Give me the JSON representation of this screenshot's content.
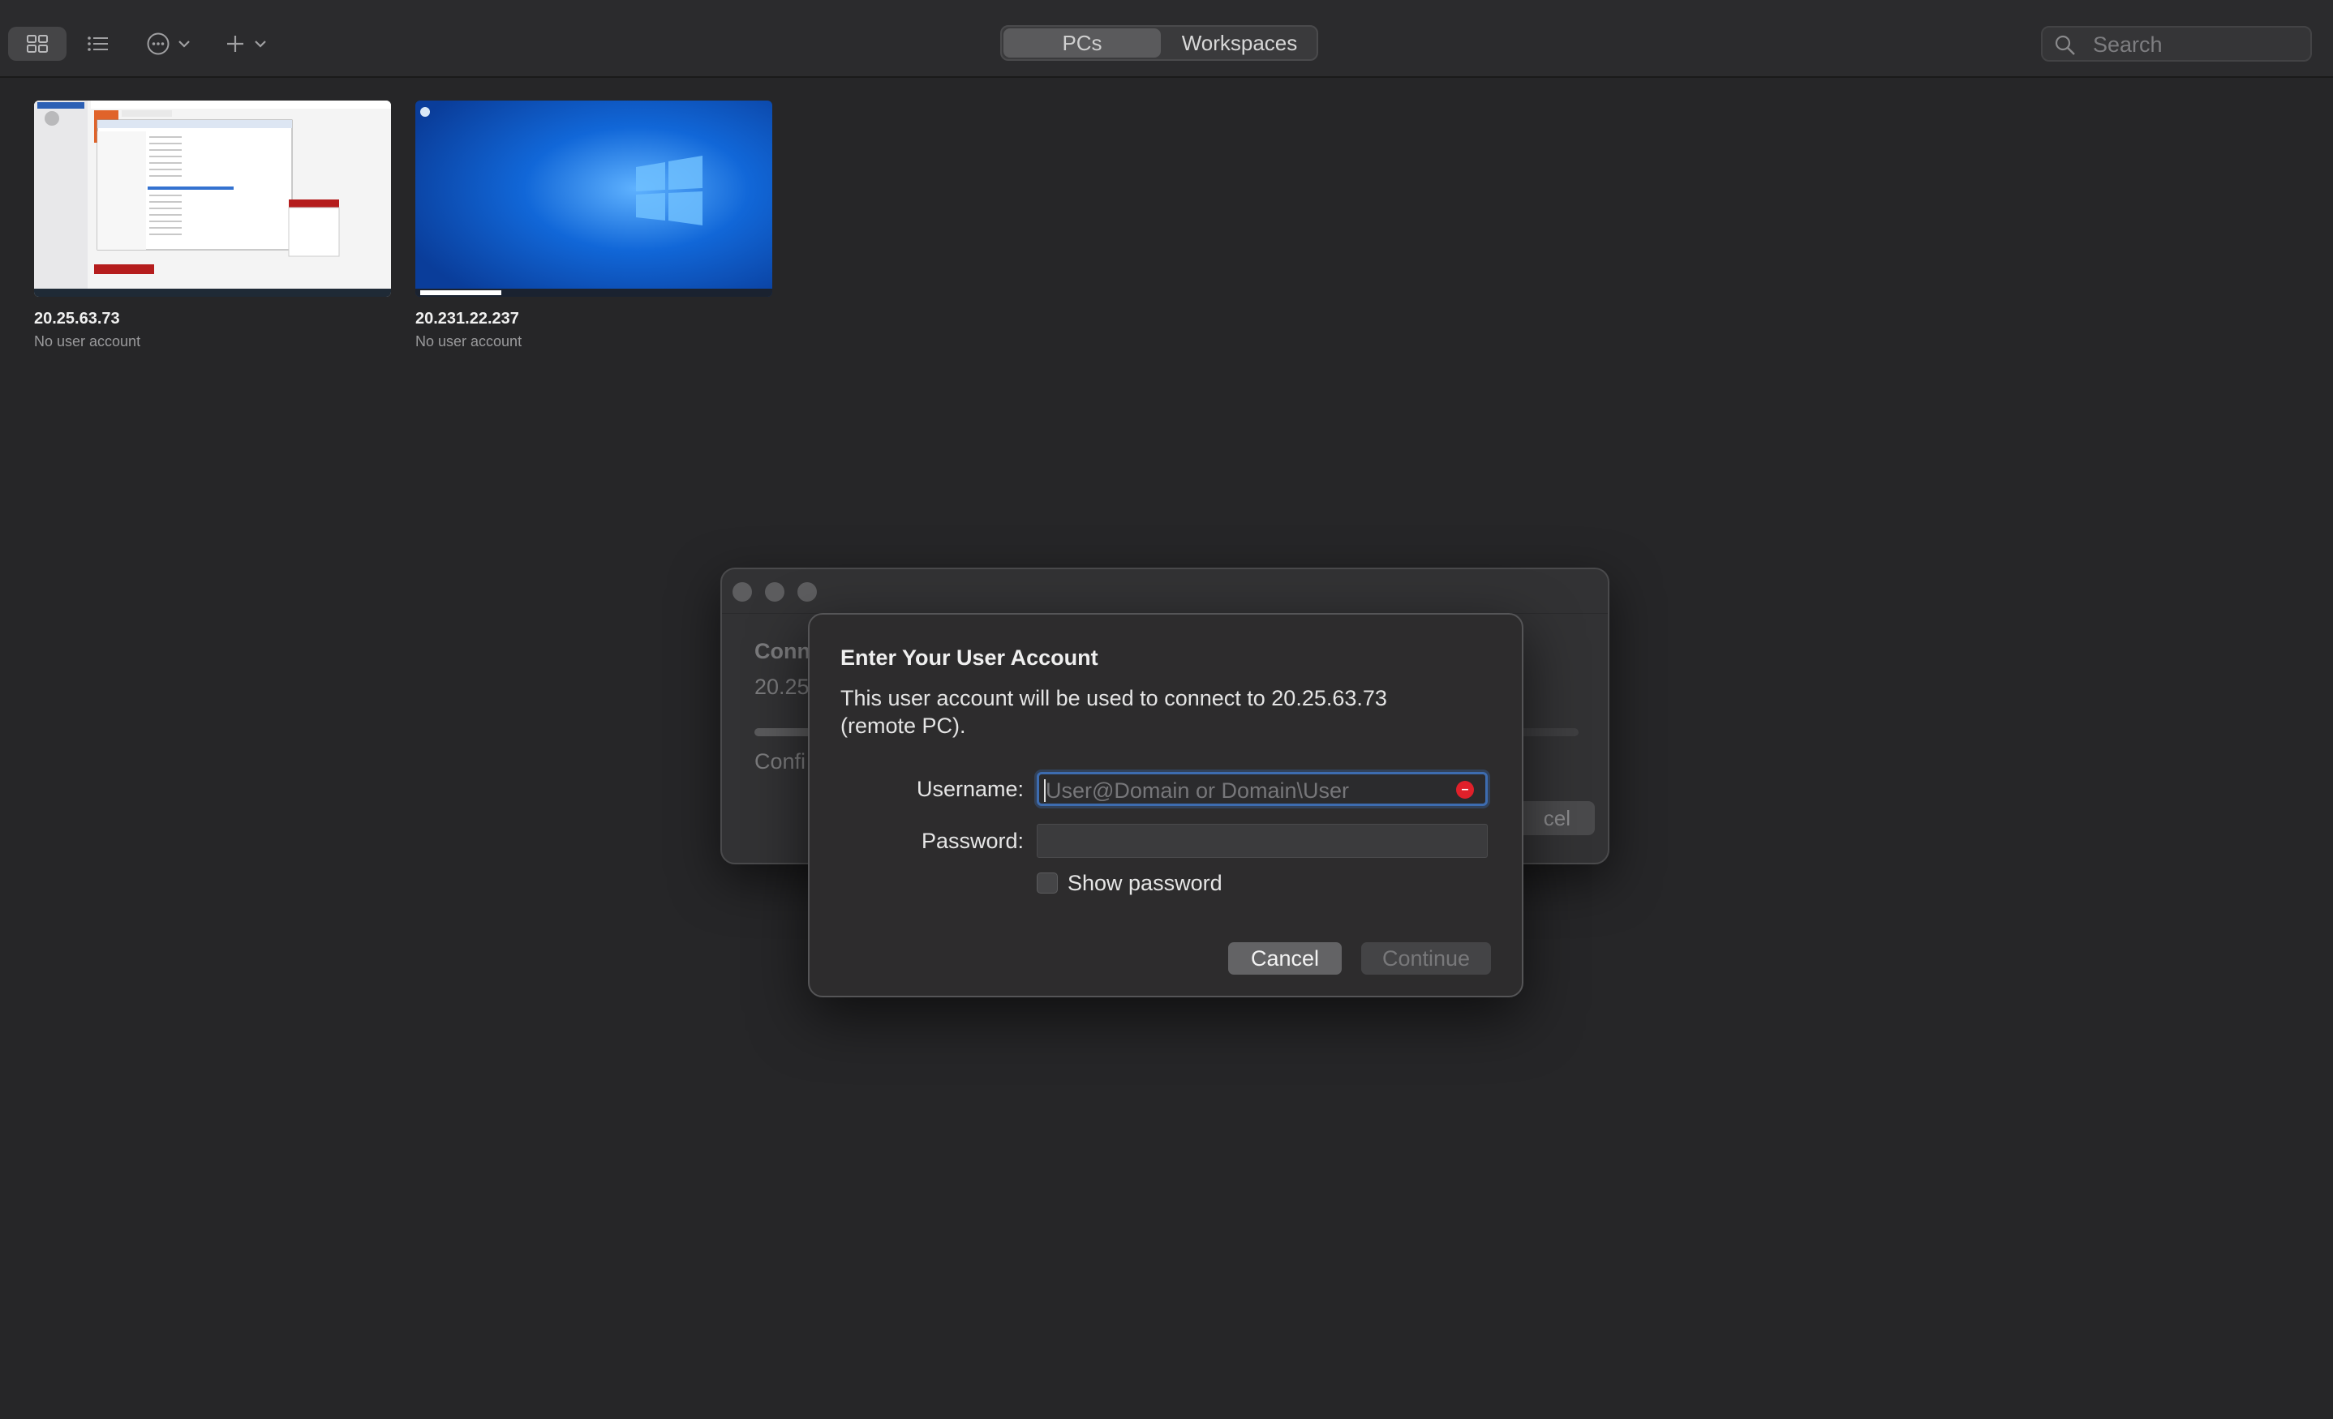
{
  "toolbar": {
    "segments": {
      "pcs": "PCs",
      "workspaces": "Workspaces"
    },
    "search_placeholder": "Search"
  },
  "pcs": [
    {
      "name": "20.25.63.73",
      "account": "No user account"
    },
    {
      "name": "20.231.22.237",
      "account": "No user account"
    }
  ],
  "background_window": {
    "title_fragment": "Conn",
    "address_fragment": "20.25",
    "status_fragment": "Confi",
    "cancel_fragment": "cel"
  },
  "dialog": {
    "title": "Enter Your User Account",
    "message": "This user account will be used to connect to 20.25.63.73 (remote PC).",
    "username_label": "Username:",
    "username_placeholder": "User@Domain or Domain\\User",
    "username_value": "",
    "password_label": "Password:",
    "password_value": "",
    "show_password_label": "Show password",
    "show_password_checked": false,
    "cancel_label": "Cancel",
    "continue_label": "Continue"
  },
  "colors": {
    "background": "#262628",
    "focus_ring": "#3d6cb0",
    "error": "#e0202a",
    "windows_wallpaper": "#1167d8"
  }
}
